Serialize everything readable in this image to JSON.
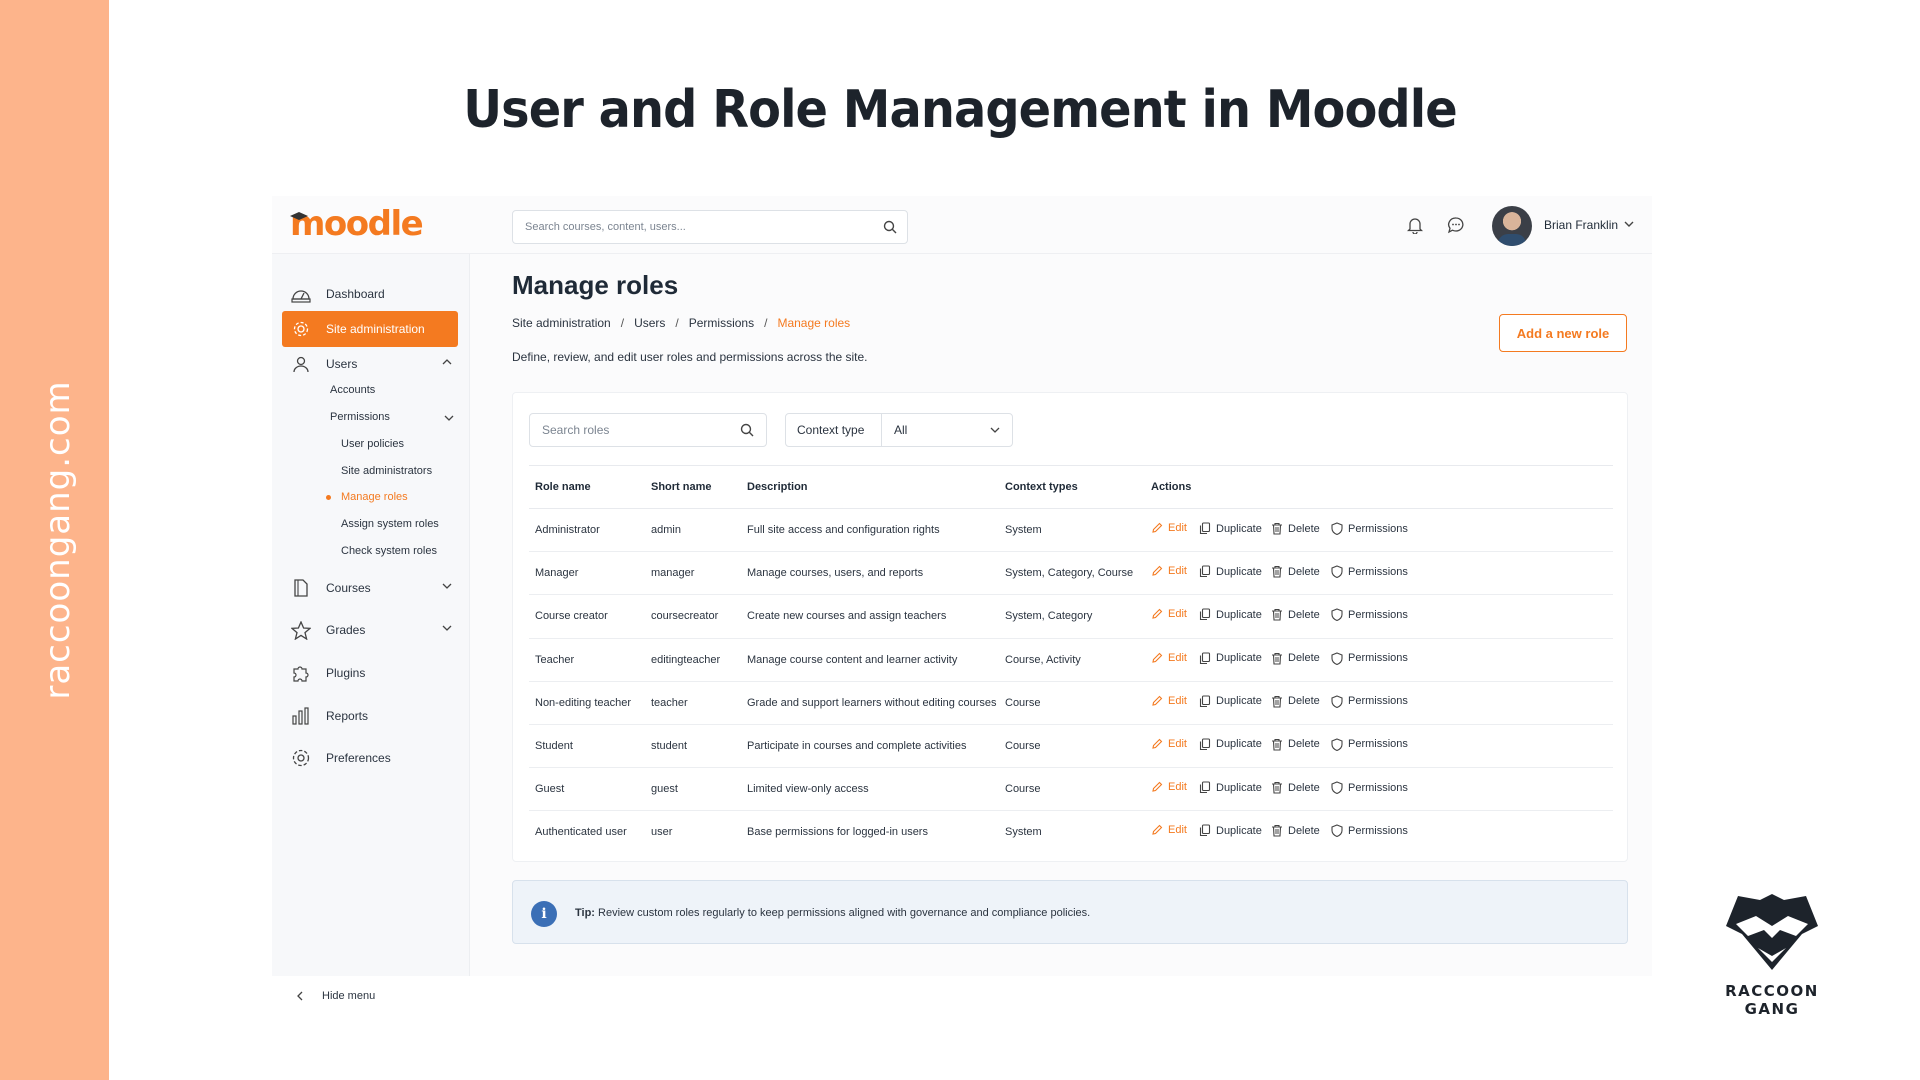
{
  "headline": "User and Role Management in Moodle",
  "side_brand": "raccoongang.com",
  "app": {
    "logo": "moodle",
    "search_placeholder": "Search courses, content, users...",
    "user_name": "Brian Franklin"
  },
  "sidebar": {
    "dashboard": "Dashboard",
    "site_admin": "Site administration",
    "users": "Users",
    "accounts": "Accounts",
    "permissions": "Permissions",
    "user_policies": "User policies",
    "site_administrators": "Site administrators",
    "manage_roles": "Manage roles",
    "assign_system_roles": "Assign system roles",
    "check_system_roles": "Check system roles",
    "courses": "Courses",
    "grades": "Grades",
    "plugins": "Plugins",
    "reports": "Reports",
    "preferences": "Preferences",
    "hide_menu": "Hide menu"
  },
  "main": {
    "title": "Manage roles",
    "breadcrumb": [
      "Site administration",
      "Users",
      "Permissions",
      "Manage roles"
    ],
    "breadcrumb_sep": "/",
    "description": "Define, review, and edit user roles and permissions across the site.",
    "add_button": "Add a new role",
    "search_roles_placeholder": "Search roles",
    "context_type_label": "Context type",
    "context_type_value": "All"
  },
  "table": {
    "headers": {
      "role_name": "Role name",
      "short_name": "Short name",
      "description": "Description",
      "context_types": "Context types",
      "actions": "Actions"
    },
    "action_labels": {
      "edit": "Edit",
      "duplicate": "Duplicate",
      "delete": "Delete",
      "permissions": "Permissions"
    },
    "rows": [
      {
        "role": "Administrator",
        "short": "admin",
        "desc": "Full site access and configuration rights",
        "ctx": "System"
      },
      {
        "role": "Manager",
        "short": "manager",
        "desc": "Manage courses, users, and reports",
        "ctx": "System, Category, Course"
      },
      {
        "role": "Course creator",
        "short": "coursecreator",
        "desc": "Create new courses and assign teachers",
        "ctx": "System, Category"
      },
      {
        "role": "Teacher",
        "short": "editingteacher",
        "desc": "Manage course content and learner activity",
        "ctx": "Course, Activity"
      },
      {
        "role": "Non-editing teacher",
        "short": "teacher",
        "desc": "Grade and support learners without editing courses",
        "ctx": "Course"
      },
      {
        "role": "Student",
        "short": "student",
        "desc": "Participate in courses and complete activities",
        "ctx": "Course"
      },
      {
        "role": "Guest",
        "short": "guest",
        "desc": "Limited view-only access",
        "ctx": "Course"
      },
      {
        "role": "Authenticated user",
        "short": "user",
        "desc": "Base permissions for logged-in users",
        "ctx": "System"
      }
    ]
  },
  "tip": {
    "label": "Tip:",
    "text": "Review custom roles regularly to keep permissions aligned with governance and compliance policies.",
    "icon": "i"
  },
  "brand": {
    "line1": "RACCOON",
    "line2": "GANG"
  },
  "colors": {
    "accent": "#f47a20",
    "stripe": "#fdb48b",
    "info": "#3b6fb6"
  }
}
